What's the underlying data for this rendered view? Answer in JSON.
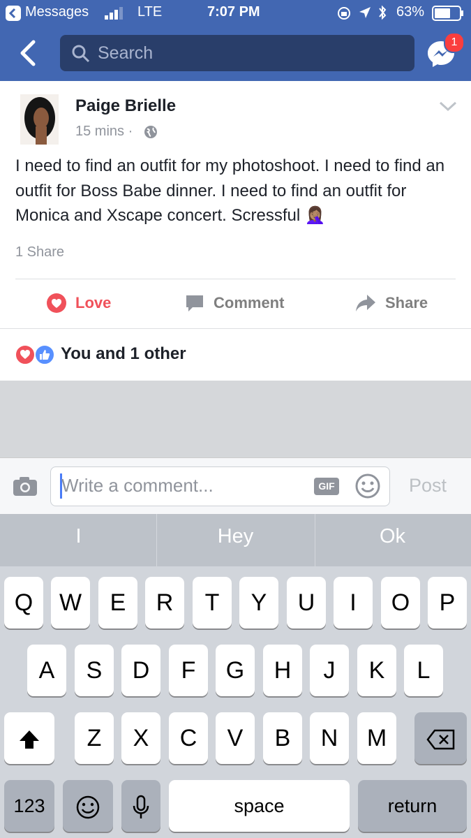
{
  "status_bar": {
    "carrier": "Messages",
    "network": "LTE",
    "time": "7:07 PM",
    "battery": "63%"
  },
  "header": {
    "search_placeholder": "Search",
    "messenger_badge": "1"
  },
  "post": {
    "author": "Paige Brielle",
    "time": "15 mins",
    "separator": "·",
    "text": "I need to find an outfit for my photoshoot. I need to find an outfit for Boss Babe dinner. I need to find an outfit for Monica and Xscape concert. Scressful",
    "emoji": "🤦🏽‍♀️",
    "shares": "1 Share"
  },
  "actions": {
    "love": "Love",
    "comment": "Comment",
    "share": "Share"
  },
  "reactions": {
    "summary": "You and 1 other"
  },
  "comment_bar": {
    "placeholder": "Write a comment...",
    "gif": "GIF",
    "post": "Post"
  },
  "keyboard": {
    "suggestions": [
      "I",
      "Hey",
      "Ok"
    ],
    "row1": [
      "Q",
      "W",
      "E",
      "R",
      "T",
      "Y",
      "U",
      "I",
      "O",
      "P"
    ],
    "row2": [
      "A",
      "S",
      "D",
      "F",
      "G",
      "H",
      "J",
      "K",
      "L"
    ],
    "row3": [
      "Z",
      "X",
      "C",
      "V",
      "B",
      "N",
      "M"
    ],
    "numbers": "123",
    "space": "space",
    "return": "return"
  },
  "colors": {
    "header_blue": "#4267b2",
    "love_red": "#f0515a",
    "like_blue": "#5890ff"
  }
}
